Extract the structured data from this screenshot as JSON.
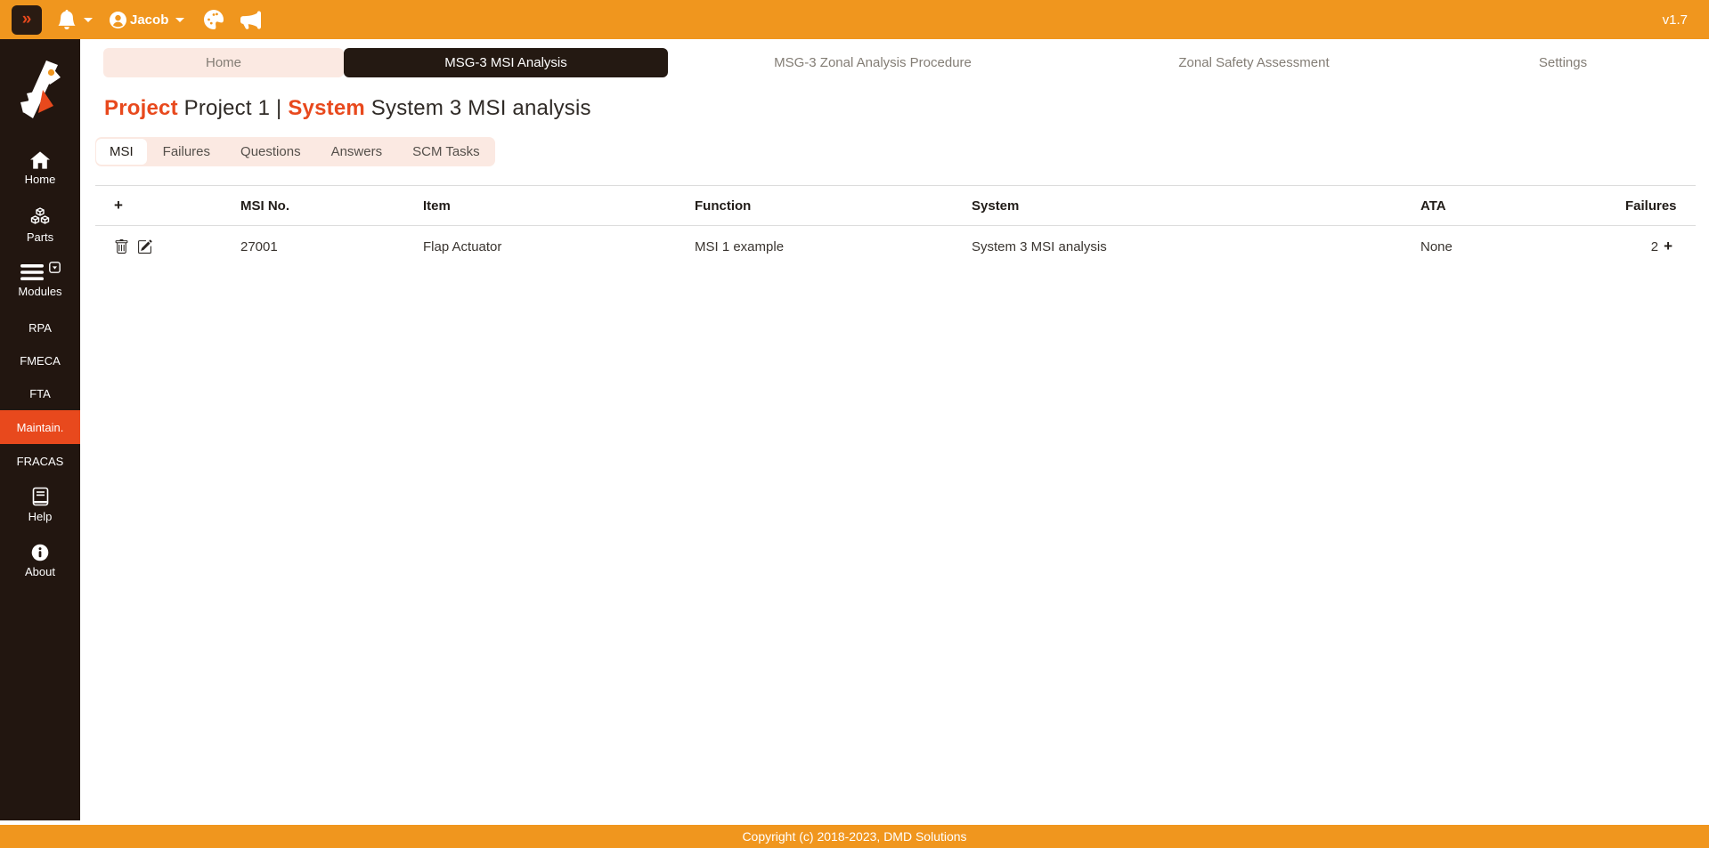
{
  "topbar": {
    "collapse_glyph": "»",
    "user": "Jacob",
    "version": "v1.7"
  },
  "sidebar": {
    "items": [
      {
        "label": "Home",
        "icon": "home"
      },
      {
        "label": "Parts",
        "icon": "cubes"
      },
      {
        "label": "Modules",
        "icon": "menu"
      },
      {
        "label": "RPA"
      },
      {
        "label": "FMECA"
      },
      {
        "label": "FTA"
      },
      {
        "label": "Maintain.",
        "active": true
      },
      {
        "label": "FRACAS"
      },
      {
        "label": "Help",
        "icon": "book"
      },
      {
        "label": "About",
        "icon": "info"
      }
    ]
  },
  "nav_tabs": [
    {
      "label": "Home"
    },
    {
      "label": "MSG-3 MSI Analysis",
      "active": true
    },
    {
      "label": "MSG-3 Zonal Analysis Procedure"
    },
    {
      "label": "Zonal Safety Assessment"
    },
    {
      "label": "Settings"
    }
  ],
  "page_title": {
    "project_label": "Project",
    "project_name": "Project 1",
    "separator": " | ",
    "system_label": "System",
    "system_name": "System 3 MSI analysis"
  },
  "sub_tabs": [
    {
      "label": "MSI",
      "active": true
    },
    {
      "label": "Failures"
    },
    {
      "label": "Questions"
    },
    {
      "label": "Answers"
    },
    {
      "label": "SCM Tasks"
    }
  ],
  "table": {
    "headers": {
      "add": "+",
      "msi_no": "MSI No.",
      "item": "Item",
      "function": "Function",
      "system": "System",
      "ata": "ATA",
      "failures": "Failures"
    },
    "rows": [
      {
        "msi_no": "27001",
        "item": "Flap Actuator",
        "function": "MSI 1 example",
        "system": "System 3 MSI analysis",
        "ata": "None",
        "failures": "2",
        "add_failure": "+"
      }
    ]
  },
  "footer": {
    "copyright": "Copyright (c) 2018-2023, DMD Solutions"
  },
  "colors": {
    "topbar_orange": "#f0961e",
    "sidebar_dark": "#221610",
    "accent_red": "#e8491d",
    "tab_pink": "#fbe9e2",
    "active_tab_dark": "#241912"
  }
}
